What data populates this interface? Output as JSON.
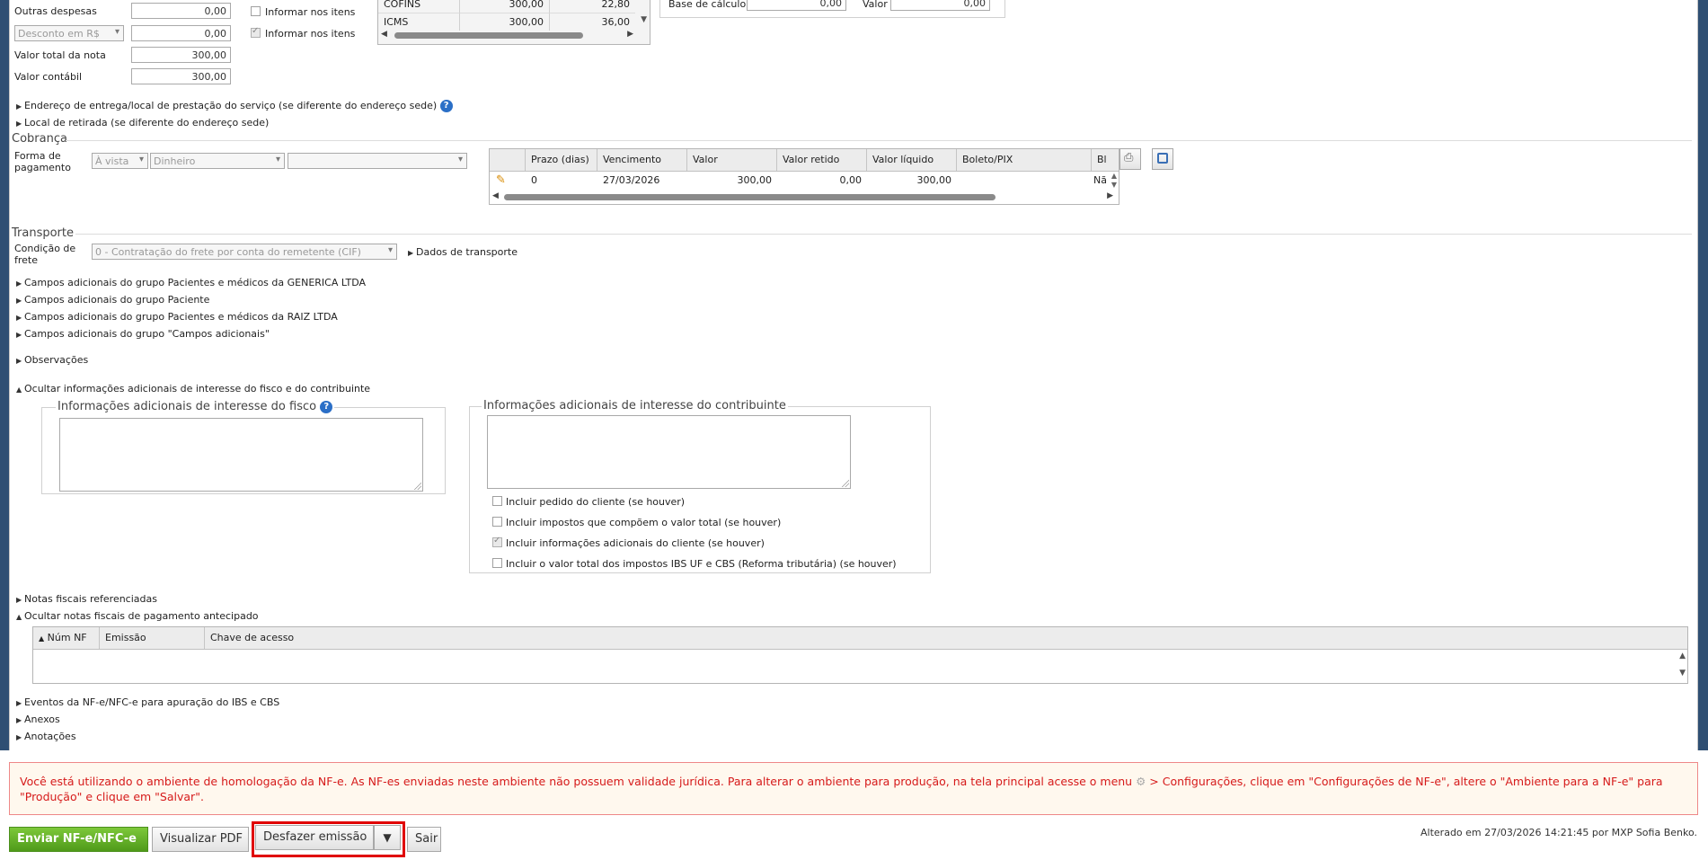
{
  "totals": {
    "outras_despesas_label": "Outras despesas",
    "outras_despesas_value": "0,00",
    "desconto_select": "Desconto em R$",
    "desconto_value": "0,00",
    "valor_total_label": "Valor total da nota",
    "valor_total_value": "300,00",
    "valor_contabil_label": "Valor contábil",
    "valor_contabil_value": "300,00",
    "informar_itens_1": "Informar nos itens",
    "informar_itens_2": "Informar nos itens"
  },
  "tax_table": {
    "rows": [
      {
        "name": "COFINS",
        "base": "300,00",
        "value": "22,80"
      },
      {
        "name": "ICMS",
        "base": "300,00",
        "value": "36,00"
      }
    ]
  },
  "retencao": {
    "base_label": "Base de cálculo",
    "base_value": "0,00",
    "valor_label": "Valor",
    "valor_value": "0,00"
  },
  "links_top": {
    "endereco_entrega": "Endereço de entrega/local de prestação do serviço (se diferente do endereço sede)",
    "local_retirada": "Local de retirada (se diferente do endereço sede)"
  },
  "cobranca": {
    "title": "Cobrança",
    "forma_label": "Forma de pagamento",
    "select_1": "À vista",
    "select_2": "Dinheiro",
    "select_3": "",
    "columns": [
      "Prazo (dias)",
      "Vencimento",
      "Valor",
      "Valor retido",
      "Valor líquido",
      "Boleto/PIX",
      "Bl"
    ],
    "row": {
      "prazo": "0",
      "vencimento": "27/03/2026",
      "valor": "300,00",
      "retido": "0,00",
      "liquido": "300,00",
      "boleto": "",
      "bl": "Nã"
    }
  },
  "transporte": {
    "title": "Transporte",
    "condicao_label": "Condição de frete",
    "condicao_value": "0 - Contratação do frete por conta do remetente (CIF)",
    "dados_link": "Dados de transporte"
  },
  "campos": [
    "Campos adicionais do grupo Pacientes e médicos da GENERICA LTDA",
    "Campos adicionais do grupo Paciente",
    "Campos adicionais do grupo Pacientes e médicos da RAIZ LTDA",
    "Campos adicionais do grupo \"Campos adicionais\""
  ],
  "observacoes": "Observações",
  "ocultar_info": "Ocultar informações adicionais de interesse do fisco e do contribuinte",
  "info_fisco_legend": "Informações adicionais de interesse do fisco",
  "info_contrib_legend": "Informações adicionais de interesse do contribuinte",
  "options": [
    {
      "label": "Incluir pedido do cliente (se houver)",
      "checked": false
    },
    {
      "label": "Incluir impostos que compõem o valor total (se houver)",
      "checked": false
    },
    {
      "label": "Incluir informações adicionais do cliente (se houver)",
      "checked": true
    },
    {
      "label": "Incluir o valor total dos impostos IBS UF e CBS (Reforma tributária) (se houver)",
      "checked": false
    }
  ],
  "notas_ref": "Notas fiscais referenciadas",
  "ocultar_notas_antecipado": "Ocultar notas fiscais de pagamento antecipado",
  "antecipado_columns": [
    "Núm NF",
    "Emissão",
    "Chave de acesso"
  ],
  "bottom_links": [
    "Eventos da NF-e/NFC-e para apuração do IBS e CBS",
    "Anexos",
    "Anotações"
  ],
  "warning": {
    "part1": "Você está utilizando o ambiente de homologação da NF-e. As NF-es enviadas neste ambiente não possuem validade jurídica. Para alterar o ambiente para produção, na tela principal acesse o menu",
    "part2": "> Configurações, clique em \"Configurações de NF-e\", altere o \"Ambiente para a NF-e\" para \"Produção\" e clique em \"Salvar\"."
  },
  "actions": {
    "enviar": "Enviar NF-e/NFC-e",
    "visualizar": "Visualizar PDF",
    "desfazer": "Desfazer emissão",
    "sair": "Sair"
  },
  "footer_status": "Alterado em 27/03/2026 14:21:45 por MXP Sofia Benko.",
  "colors": {
    "warning_text": "#d61a1a",
    "primary_button": "#5ca824",
    "highlight_border": "#e00000"
  }
}
